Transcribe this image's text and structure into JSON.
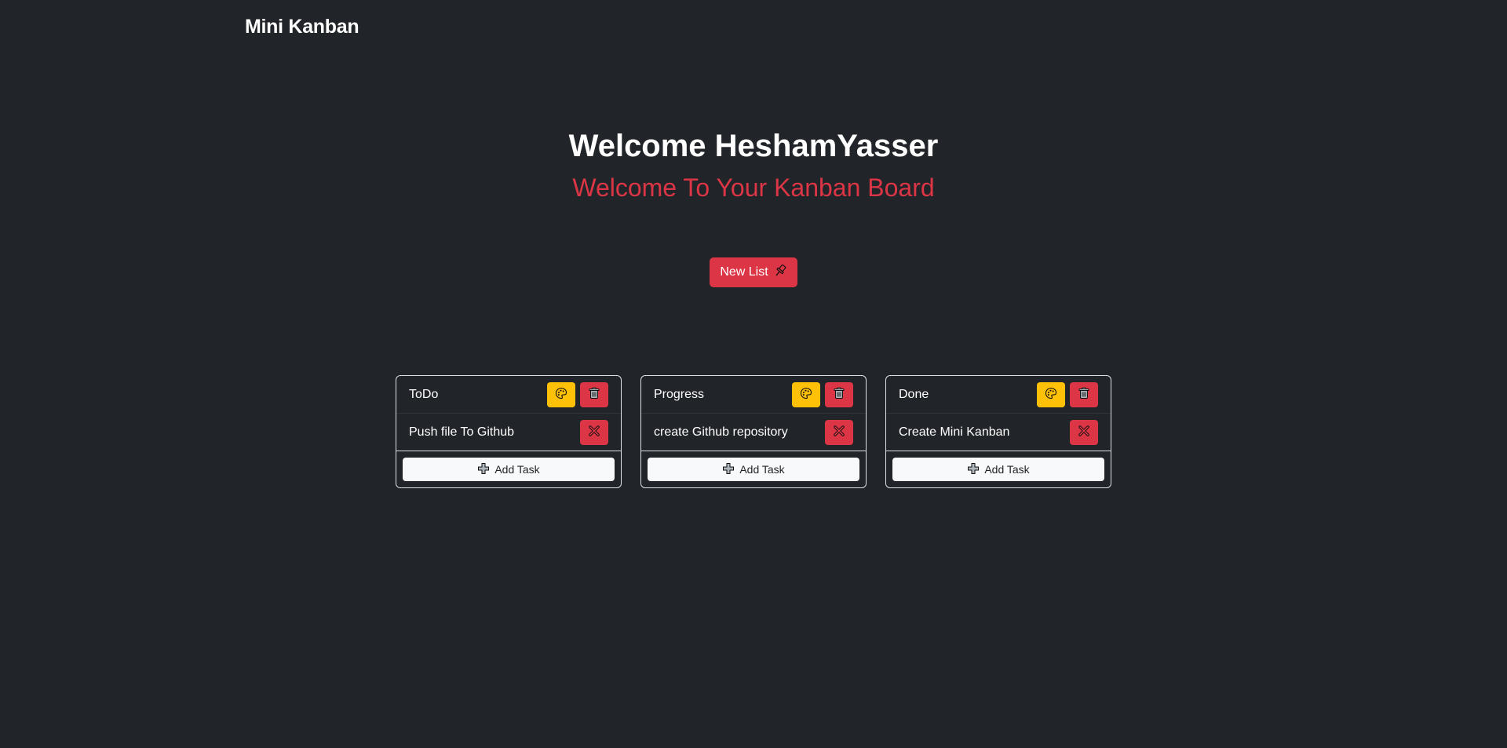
{
  "navbar": {
    "brand": "Mini Kanban"
  },
  "hero": {
    "title": "Welcome HeshamYasser",
    "subtitle": "Welcome To Your Kanban Board"
  },
  "new_list": {
    "label": "New List",
    "icon": "pushpin-icon"
  },
  "colors": {
    "background": "#212529",
    "danger": "#dc3545",
    "warning": "#ffc107",
    "light": "#f8f9fa"
  },
  "lists": [
    {
      "title": "ToDo",
      "tasks": [
        {
          "text": "Push file To Github"
        }
      ],
      "add_task_label": "Add Task"
    },
    {
      "title": "Progress",
      "tasks": [
        {
          "text": "create Github repository"
        }
      ],
      "add_task_label": "Add Task"
    },
    {
      "title": "Done",
      "tasks": [
        {
          "text": "Create Mini Kanban"
        }
      ],
      "add_task_label": "Add Task"
    }
  ]
}
